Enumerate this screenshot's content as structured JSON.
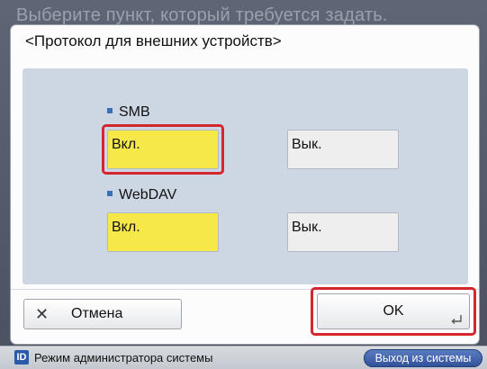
{
  "background": {
    "title": "Выберите пункт, который требуется задать."
  },
  "dialog": {
    "title": "<Протокол для внешних устройств>",
    "sections": [
      {
        "label": "SMB",
        "on_label": "Вкл.",
        "off_label": "Вык.",
        "selected": "on"
      },
      {
        "label": "WebDAV",
        "on_label": "Вкл.",
        "off_label": "Вык.",
        "selected": "on"
      }
    ],
    "cancel_label": "Отмена",
    "cancel_icon": "close-icon",
    "ok_label": "OK",
    "ok_icon": "enter-icon"
  },
  "statusbar": {
    "admin_icon_letter": "ID",
    "admin_text": "Режим администратора системы",
    "logout_label": "Выход из системы"
  },
  "colors": {
    "selected_fill": "#f7e84a",
    "highlight_frame": "#d3262f",
    "panel": "#cdd7e4"
  }
}
